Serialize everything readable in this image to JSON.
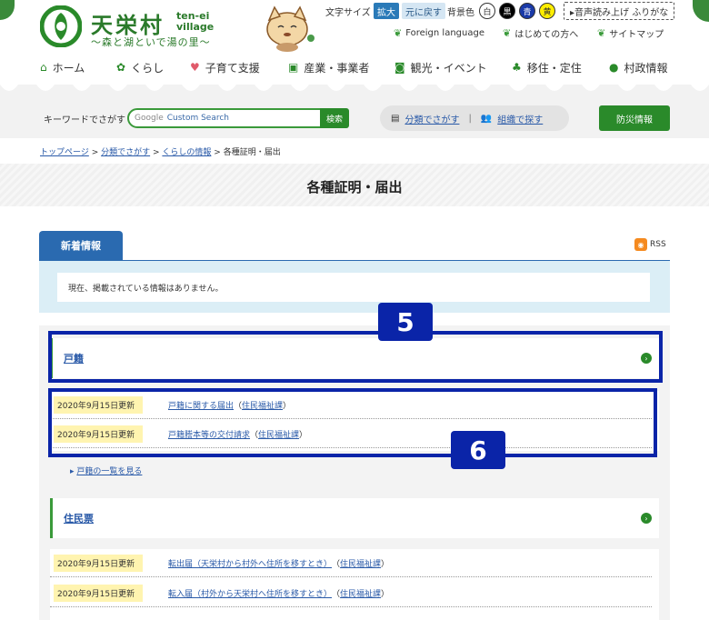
{
  "logo": {
    "title": "天栄村",
    "en_line1": "ten-ei",
    "en_line2": "village",
    "subtitle": "～森と湖といで湯の里～"
  },
  "util": {
    "font_size_label": "文字サイズ",
    "enlarge": "拡大",
    "reset": "元に戻す",
    "bg_label": "背景色",
    "bg_white": "白",
    "bg_black": "黒",
    "bg_blue": "青",
    "bg_yellow": "黄",
    "voice": "▸音声読み上げ ふりがな"
  },
  "sublinks": {
    "foreign": "Foreign language",
    "first": "はじめての方へ",
    "sitemap": "サイトマップ"
  },
  "gnav": [
    "ホーム",
    "くらし",
    "子育て支援",
    "産業・事業者",
    "観光・イベント",
    "移住・定住",
    "村政情報"
  ],
  "search": {
    "label": "キーワードでさがす",
    "placeholder_g": "Google",
    "placeholder": "Custom Search",
    "button": "検索",
    "by_category": "分類でさがす",
    "by_org": "組織で探す",
    "bousai": "防災情報"
  },
  "breadcrumb": {
    "top": "トップページ",
    "cat": "分類でさがす",
    "life": "くらしの情報",
    "current": "各種証明・届出"
  },
  "page_title": "各種証明・届出",
  "new_info": {
    "tab": "新着情報",
    "rss": "RSS",
    "message": "現在、掲載されている情報はありません。"
  },
  "categories": [
    {
      "name": "戸籍",
      "items": [
        {
          "date": "2020年9月15日更新",
          "title": "戸籍に関する届出",
          "dept": "住民福祉課"
        },
        {
          "date": "2020年9月15日更新",
          "title": "戸籍謄本等の交付請求",
          "dept": "住民福祉課"
        }
      ],
      "more": "戸籍の一覧を見る"
    },
    {
      "name": "住民票",
      "items": [
        {
          "date": "2020年9月15日更新",
          "title": "転出届（天栄村から村外へ住所を移すとき）",
          "dept": "住民福祉課"
        },
        {
          "date": "2020年9月15日更新",
          "title": "転入届（村外から天栄村へ住所を移すとき）",
          "dept": "住民福祉課"
        }
      ]
    }
  ],
  "annotations": {
    "box5": "5",
    "box6": "6"
  },
  "colors": {
    "green": "#2a8a2a",
    "blue": "#2a6ab0",
    "annotation": "#0a24a8"
  }
}
